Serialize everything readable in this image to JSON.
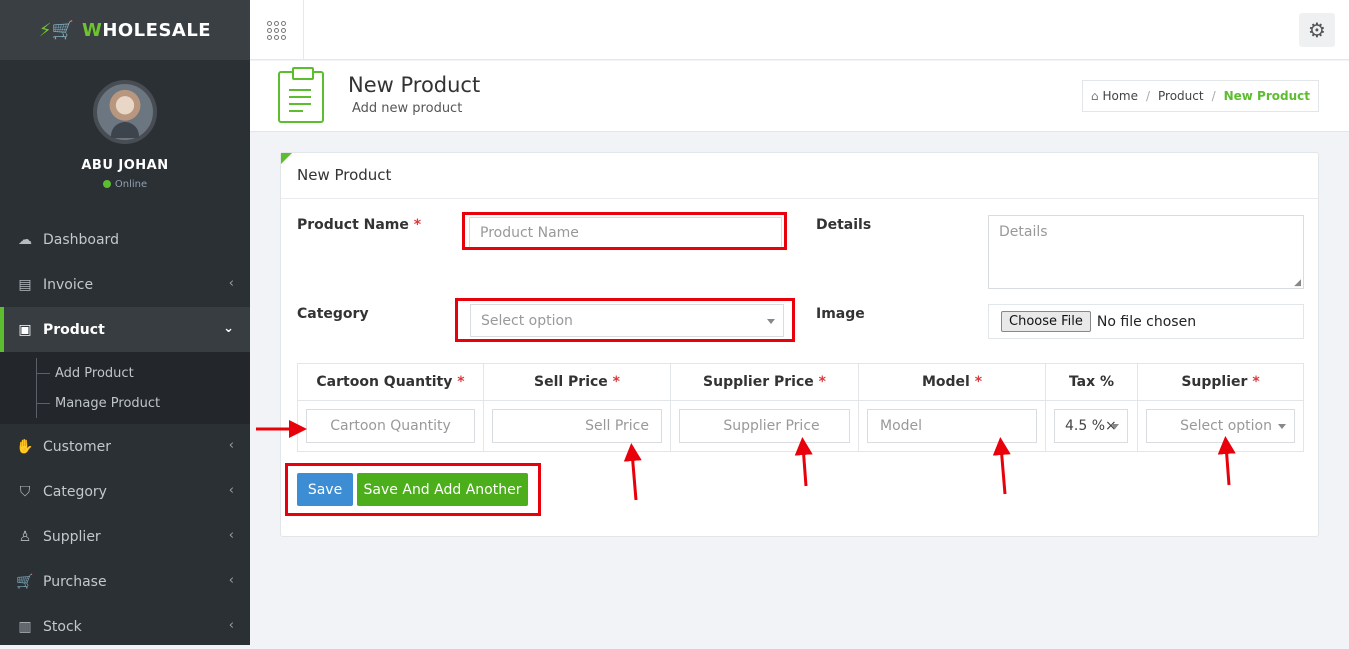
{
  "brand": {
    "name_prefix": "W",
    "name": "HOLESALE"
  },
  "profile": {
    "name": "ABU JOHAN",
    "status": "Online"
  },
  "menu": {
    "dashboard": "Dashboard",
    "invoice": "Invoice",
    "product": "Product",
    "add_product": "Add Product",
    "manage_product": "Manage Product",
    "customer": "Customer",
    "category": "Category",
    "supplier": "Supplier",
    "purchase": "Purchase",
    "stock": "Stock"
  },
  "header": {
    "title": "New Product",
    "subtitle": "Add new product"
  },
  "breadcrumb": {
    "home": "Home",
    "section": "Product",
    "current": "New Product"
  },
  "form": {
    "panel_title": "New Product",
    "product_name_label": "Product Name",
    "product_name_placeholder": "Product Name",
    "details_label": "Details",
    "details_placeholder": "Details",
    "category_label": "Category",
    "category_placeholder": "Select option",
    "image_label": "Image",
    "file_button": "Choose File",
    "file_status": "No file chosen",
    "required_mark": "*"
  },
  "table": {
    "headers": [
      "Cartoon Quantity",
      "Sell Price",
      "Supplier Price",
      "Model",
      "Tax %",
      "Supplier"
    ],
    "placeholders": {
      "cartoon_quantity": "Cartoon Quantity",
      "sell_price": "Sell Price",
      "supplier_price": "Supplier Price",
      "model": "Model",
      "tax": "4.5 %×",
      "supplier": "Select option"
    }
  },
  "buttons": {
    "save": "Save",
    "save_add": "Save And Add Another"
  },
  "colors": {
    "accent_green": "#5cbd2f",
    "save_blue": "#3c8dd4",
    "annotation_red": "#e8000a"
  }
}
